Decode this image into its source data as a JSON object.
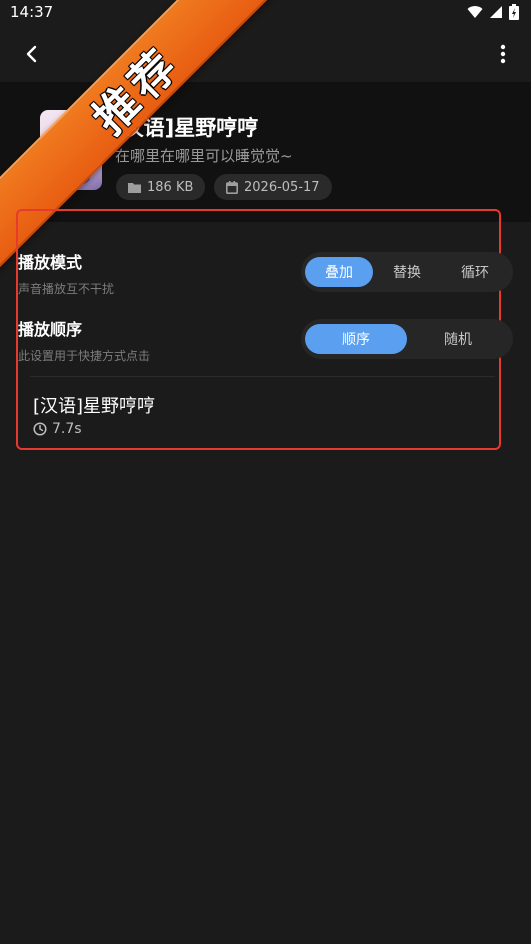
{
  "status_bar": {
    "time": "14:37"
  },
  "header": {
    "title": "[汉语]星野哼哼",
    "subtitle": "在哪里在哪里可以睡觉觉~",
    "file_size": "186 KB",
    "date": "2026-05-17"
  },
  "banner": {
    "label": "推荐",
    "color": "#ef6c1a"
  },
  "play_mode": {
    "label": "播放模式",
    "hint": "声音播放互不干扰",
    "options": [
      "叠加",
      "替换",
      "循环"
    ],
    "selected": "叠加"
  },
  "play_order": {
    "label": "播放顺序",
    "hint": "此设置用于快捷方式点击",
    "options": [
      "顺序",
      "随机"
    ],
    "selected": "顺序"
  },
  "track": {
    "title": "[汉语]星野哼哼",
    "duration": "7.7s"
  },
  "colors": {
    "accent": "#5b9ff0",
    "highlight_border": "#e53a2d",
    "background": "#1b1b1b"
  },
  "icons": [
    "back-arrow-icon",
    "more-vert-icon",
    "folder-icon",
    "calendar-icon",
    "clock-icon",
    "wifi-icon",
    "signal-icon",
    "battery-icon"
  ]
}
